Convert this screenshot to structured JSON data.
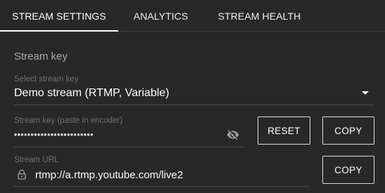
{
  "tabs": [
    {
      "label": "STREAM SETTINGS",
      "active": true
    },
    {
      "label": "ANALYTICS",
      "active": false
    },
    {
      "label": "STREAM HEALTH",
      "active": false
    }
  ],
  "stream_key_section": {
    "title": "Stream key",
    "select": {
      "label": "Select stream key",
      "value": "Demo stream (RTMP, Variable)"
    },
    "key_field": {
      "label": "Stream key (paste in encoder)",
      "value": "••••••••••••••••••••••••",
      "visibility_icon": "eye-off-icon"
    },
    "reset_label": "RESET",
    "copy_key_label": "COPY",
    "url_field": {
      "label": "Stream URL",
      "value": "rtmp://a.rtmp.youtube.com/live2",
      "lock_icon": "lock-icon"
    },
    "copy_url_label": "COPY"
  },
  "colors": {
    "background": "#282828",
    "text": "#ffffff",
    "label": "#717171",
    "section_title": "#aaaaaa"
  }
}
